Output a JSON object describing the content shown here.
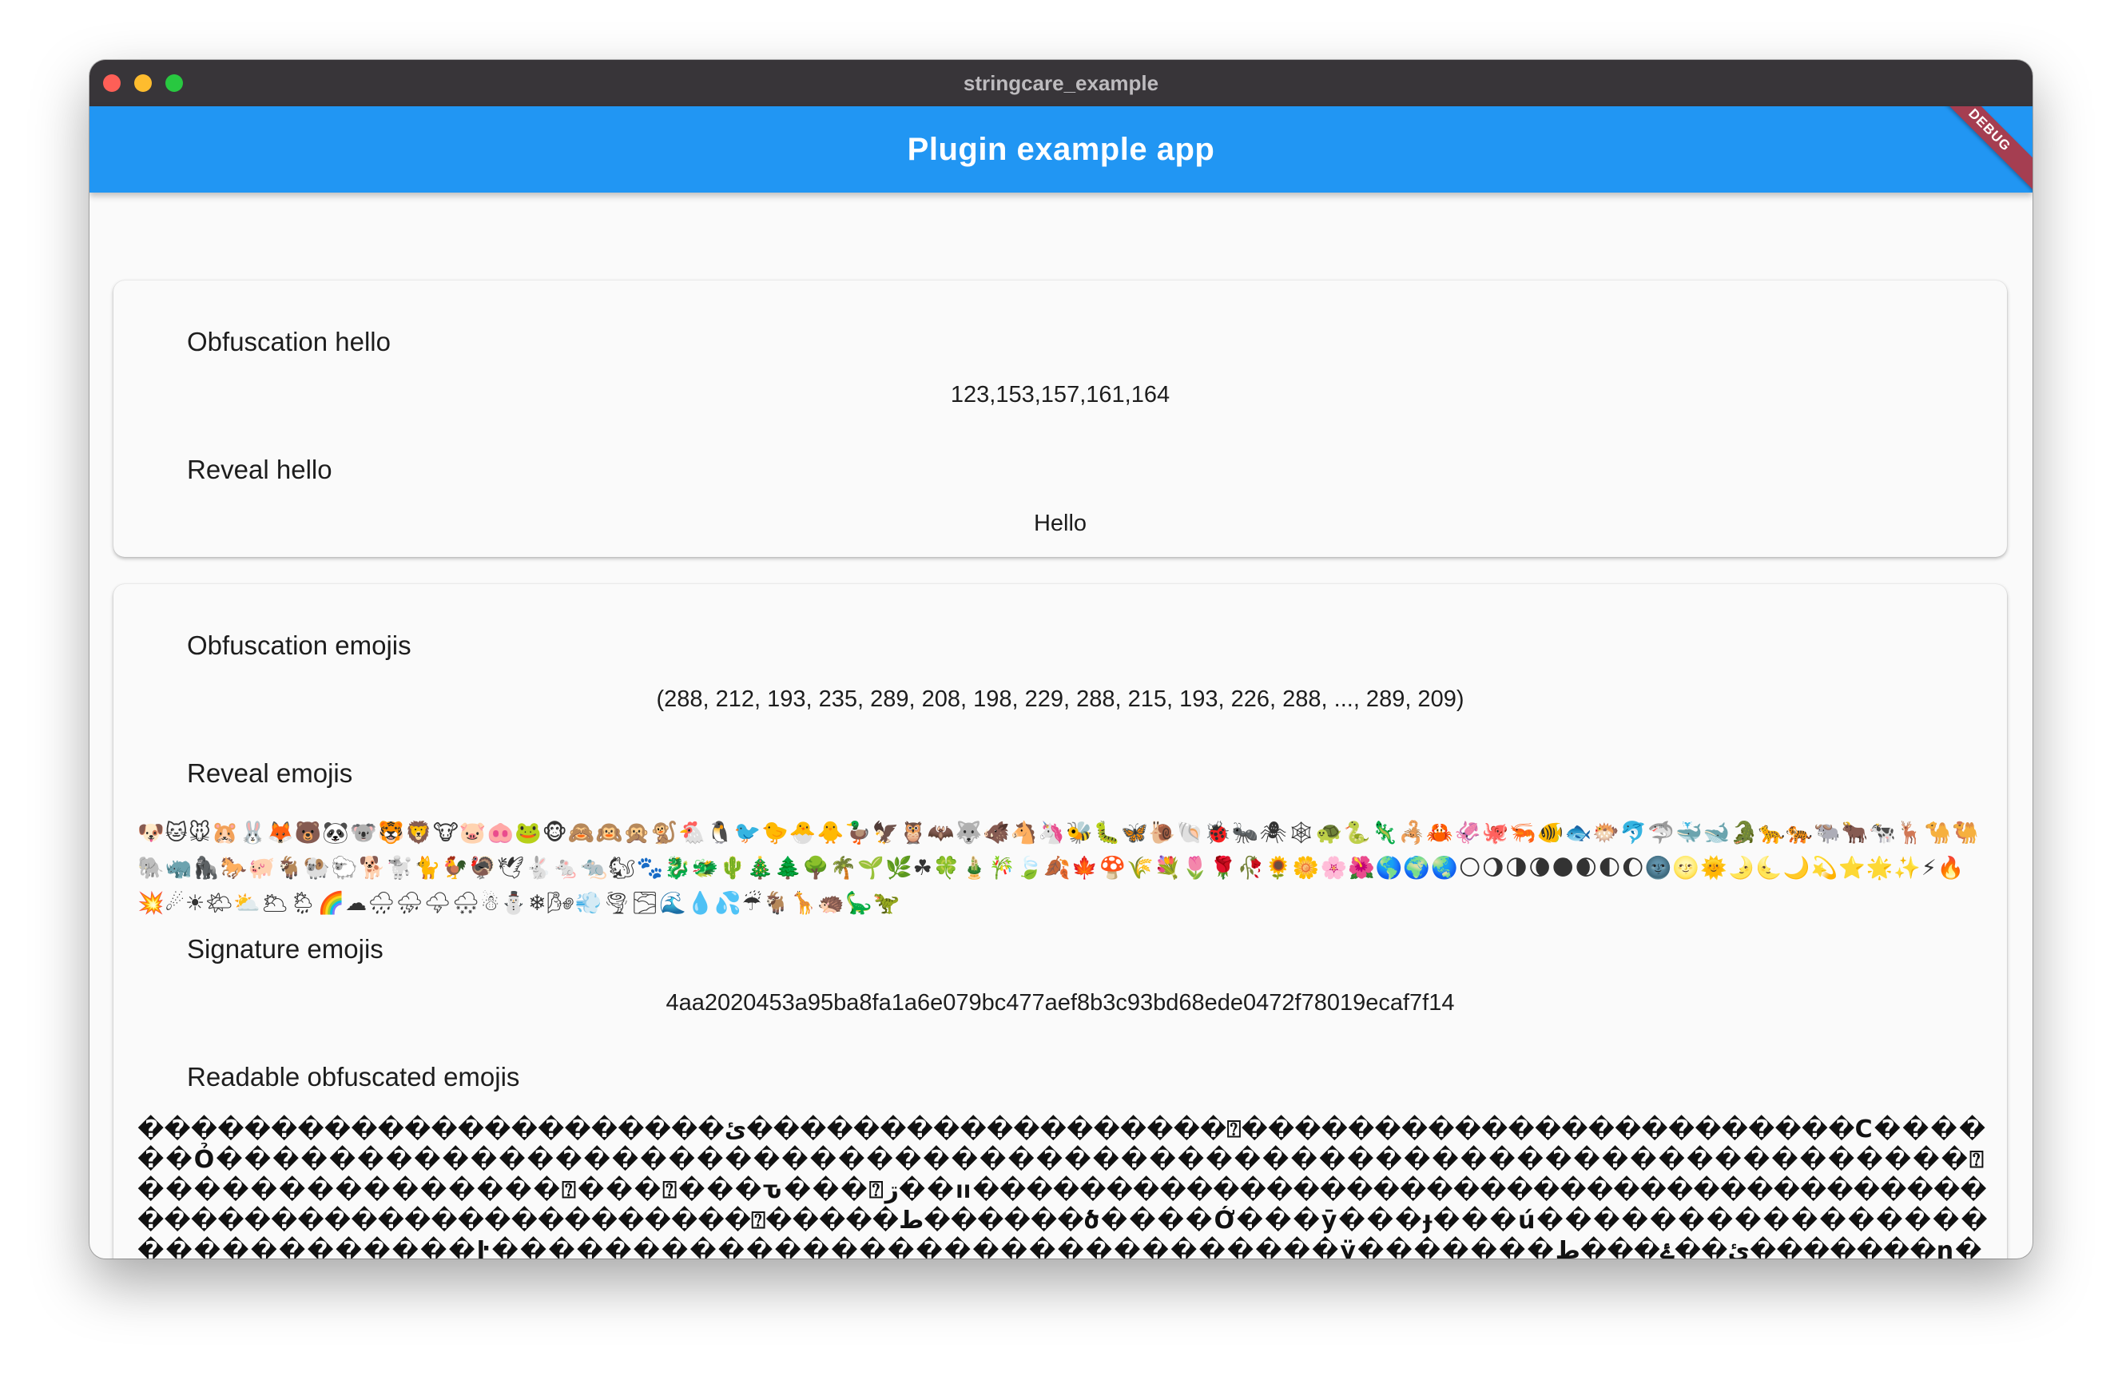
{
  "window": {
    "title": "stringcare_example"
  },
  "appbar": {
    "title": "Plugin example app",
    "color": "#2196f3",
    "debug_banner": "DEBUG"
  },
  "card1": {
    "obfuscation_label": "Obfuscation hello",
    "obfuscation_value": "123,153,157,161,164",
    "reveal_label": "Reveal hello",
    "reveal_value": "Hello"
  },
  "card2": {
    "obfuscation_label": "Obfuscation emojis",
    "obfuscation_value": "(288, 212, 193, 235, 289, 208, 198, 229, 288, 215, 193, 226, 288, ..., 289, 209)",
    "reveal_label": "Reveal emojis",
    "reveal_value": "🐶🐱🐭🐹🐰🦊🐻🐼🐨🐯🦁🐮🐷🐽🐸🐵🙈🙉🙊🐒🐔🐧🐦🐤🐣🐥🦆🦅🦉🦇🐺🐗🐴🦄🐝🐛🦋🐌🐚🐞🐜🕷🕸🐢🐍🦎🦂🦀🦑🐙🦐🐠🐟🐡🐬🦈🐳🐋🐊🐆🐅🐃🐂🐄🦌🐪🐫🐘🦏🦍🐎🐖🐐🐏🐑🐕🐩🐈🐓🦃🕊🐇🐁🐀🐿🐾🐉🐲🌵🎄🌲🌳🌴🌱🌿☘🍀🎍🎋🍃🍂🍁🍄🌾💐🌷🌹🥀🌻🌼🌸🌺🌎🌍🌏🌕🌖🌗🌘🌑🌒🌓🌔🌚🌝🌞🌛🌜🌙💫⭐🌟✨⚡🔥💥☄☀🌤⛅🌥🌦🌈☁🌧⛈🌩🌨☃⛄❄🌬💨🌪🌫🌊💧💦☔🐐🦒🦔🦕🦖",
    "signature_label": "Signature emojis",
    "signature_value": "4aa2020453a95ba8fa1a6e079bc477aef8b3c93bd68ede0472f78019ecaf7f14",
    "readable_label": "Readable obfuscated emojis",
    "readable_value": "����������������������ئ������������������⍰�����������������������Ϲ������Ỏ��������������������������������������������������������������⍰���������������⍰���⍰���ԏ���⍰װ��ڗ�������������������������������������������������������������⍰�����ط������ծ����Ớ���ӯ���ɟ���ú����������������������������ŀ������������������������������ÿ�������ئ��ۓ���ط�������η��������������������⍰����Ż�ս����������Ѿ���м���������������������ɯ���������ø�������õ���ø⍰������������������������������������ڪ�����ս���Ґ�����Ѿ���м���ɕ���х������������������������ս�������������������������ę���Ͼ�������������������������"
  }
}
